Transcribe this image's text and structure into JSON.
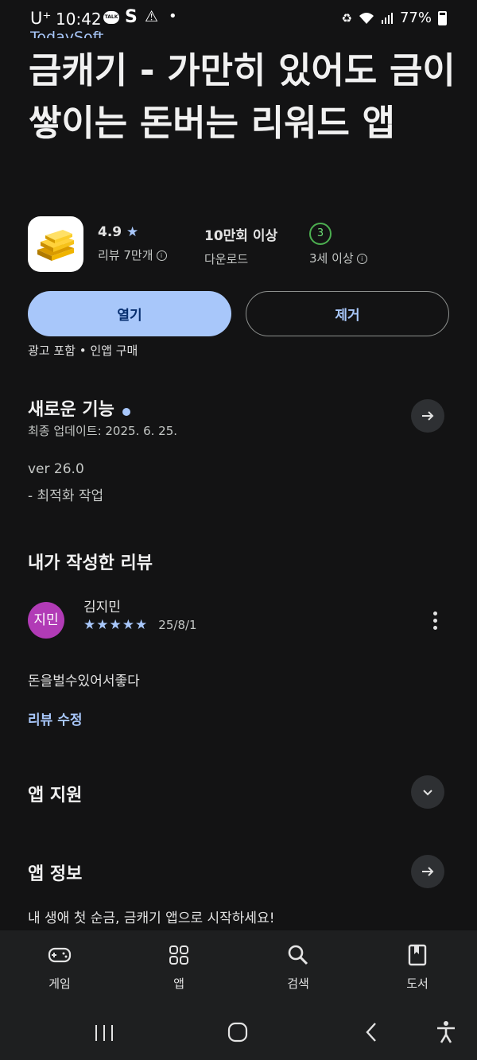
{
  "status_bar": {
    "carrier": "U⁺",
    "time": "10:42",
    "talk_badge": "TALK",
    "battery": "77%"
  },
  "app": {
    "developer": "TodaySoft",
    "title": "금캐기 - 가만히 있어도 금이 쌓이는 돈버는 리워드 앱",
    "rating": "4.9",
    "reviews_label": "리뷰 7만개",
    "downloads": "10만회 이상",
    "downloads_label": "다운로드",
    "age_value": "3",
    "age_label": "3세 이상",
    "open_label": "열기",
    "remove_label": "제거",
    "ad_line": "광고 포함 • 인앱 구매"
  },
  "whats_new": {
    "title": "새로운 기능",
    "updated": "최종 업데이트: 2025. 6. 25.",
    "version": "ver 26.0",
    "note": "- 최적화 작업"
  },
  "my_review": {
    "title": "내가 작성한 리뷰",
    "avatar_text": "지민",
    "name": "김지민",
    "stars": 5,
    "date": "25/8/1",
    "text": "돈을벌수있어서좋다",
    "edit_label": "리뷰 수정"
  },
  "app_support": {
    "title": "앱 지원"
  },
  "app_info": {
    "title": "앱 정보",
    "description": "내 생애 첫 순금, 금캐기 앱으로 시작하세요!"
  },
  "bottom_nav": {
    "items": [
      {
        "label": "게임",
        "icon": "gamepad-icon"
      },
      {
        "label": "앱",
        "icon": "apps-grid-icon"
      },
      {
        "label": "검색",
        "icon": "search-icon"
      },
      {
        "label": "도서",
        "icon": "book-icon"
      }
    ]
  },
  "colors": {
    "background": "#131314",
    "accent": "#a8c7fa",
    "avatar": "#b13bb6",
    "age_badge": "#4caf50"
  }
}
